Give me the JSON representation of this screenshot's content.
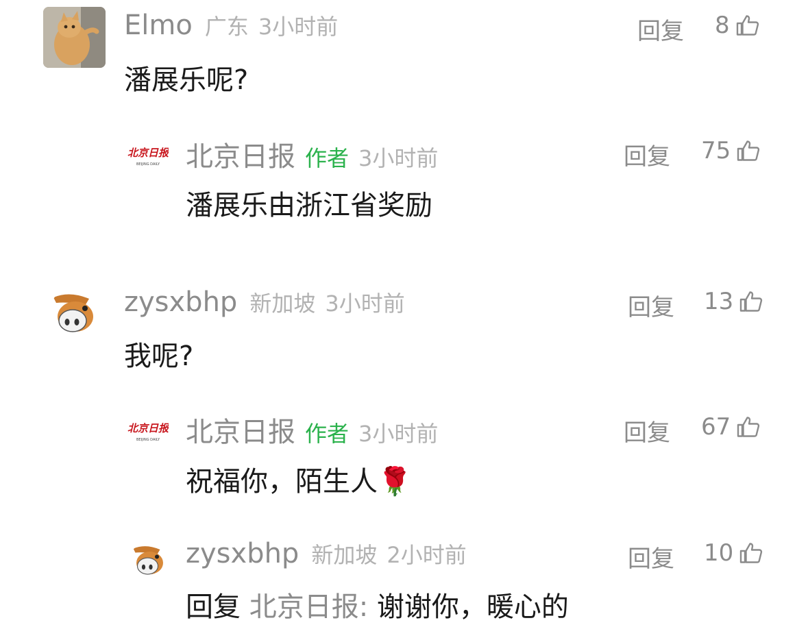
{
  "comments": [
    {
      "user": "Elmo",
      "location": "广东",
      "time": "3小时前",
      "reply_label": "回复",
      "likes": "8",
      "text": "潘展乐呢?",
      "avatar": "cat-photo-avatar"
    },
    {
      "user": "北京日报",
      "badge": "作者",
      "time": "3小时前",
      "reply_label": "回复",
      "likes": "75",
      "text": "潘展乐由浙江省奖励",
      "avatar": "beijing-daily-logo",
      "logo_text": "北京日报",
      "logo_sub": "BEIJING DAILY"
    },
    {
      "user": "zysxbhp",
      "location": "新加坡",
      "time": "3小时前",
      "reply_label": "回复",
      "likes": "13",
      "text": "我呢?",
      "avatar": "cartoon-bird-avatar"
    },
    {
      "user": "北京日报",
      "badge": "作者",
      "time": "3小时前",
      "reply_label": "回复",
      "likes": "67",
      "text": "祝福你，陌生人🌹",
      "avatar": "beijing-daily-logo",
      "logo_text": "北京日报",
      "logo_sub": "BEIJING DAILY"
    },
    {
      "user": "zysxbhp",
      "location": "新加坡",
      "time": "2小时前",
      "reply_label": "回复",
      "likes": "10",
      "reply_prefix": "回复",
      "reply_target": "北京日报:",
      "text": "谢谢你，暖心的",
      "avatar": "cartoon-bird-avatar"
    }
  ],
  "colors": {
    "username": "#8b8b8b",
    "meta": "#b2b2b2",
    "author_badge": "#2bb24c",
    "body_text": "#1a1a1a",
    "logo_red": "#c8161d"
  },
  "icons": [
    "thumbs-up-icon"
  ]
}
